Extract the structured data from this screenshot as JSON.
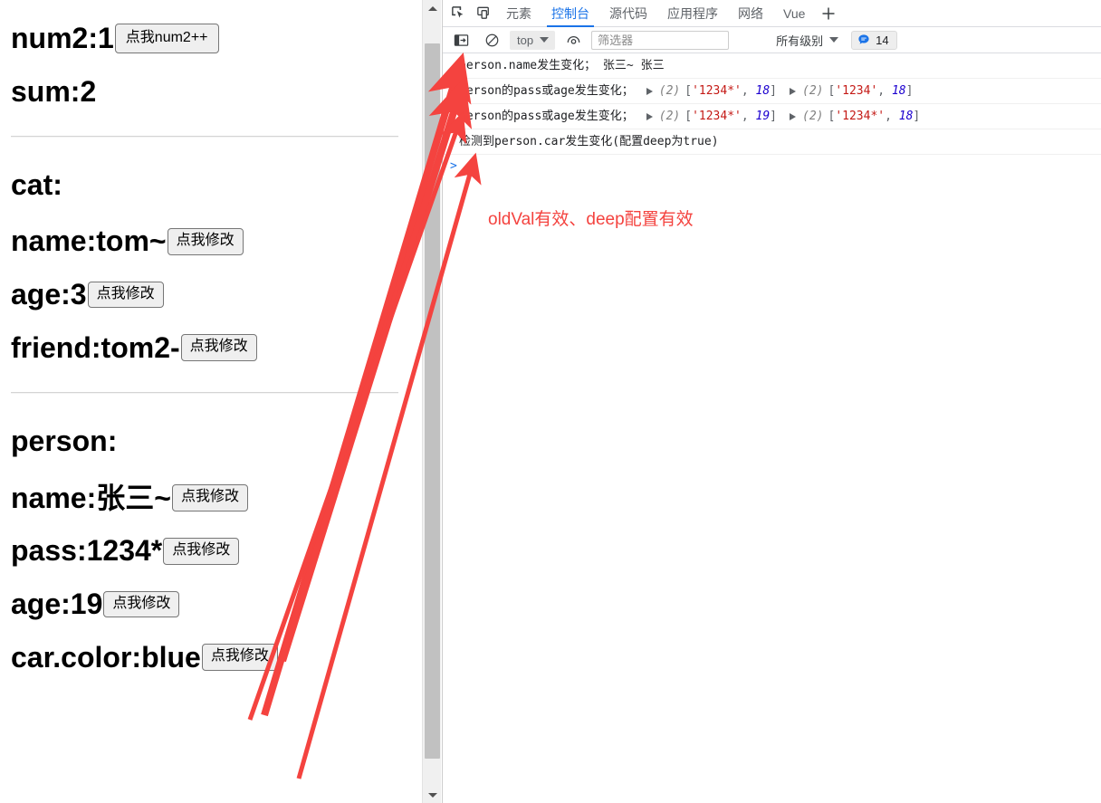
{
  "page": {
    "clipped_button_above": "",
    "rows": [
      {
        "label": "num2:",
        "value": "1",
        "button": "点我num2++",
        "wide": true
      },
      {
        "label": "sum:",
        "value": "2",
        "button": null
      }
    ],
    "cat_heading": "cat:",
    "cat_rows": [
      {
        "label": "name:",
        "value": "tom~",
        "button": "点我修改"
      },
      {
        "label": "age:",
        "value": "3",
        "button": "点我修改"
      },
      {
        "label": "friend:",
        "value": "tom2-",
        "button": "点我修改"
      }
    ],
    "person_heading": "person:",
    "person_rows": [
      {
        "label": "name:",
        "value": "张三~",
        "button": "点我修改"
      },
      {
        "label": "pass:",
        "value": "1234*",
        "button": "点我修改"
      },
      {
        "label": "age:",
        "value": "19",
        "button": "点我修改"
      },
      {
        "label": "car.color:",
        "value": "blue",
        "button": "点我修改"
      }
    ]
  },
  "devtools": {
    "tabs": [
      {
        "label": "元素",
        "active": false
      },
      {
        "label": "控制台",
        "active": true
      },
      {
        "label": "源代码",
        "active": false
      },
      {
        "label": "应用程序",
        "active": false
      },
      {
        "label": "网络",
        "active": false
      },
      {
        "label": "Vue",
        "active": false
      }
    ],
    "more_tabs_label": "+",
    "toolbar": {
      "context": "top",
      "filter_placeholder": "筛选器",
      "filter_value": "",
      "level": "所有级别",
      "message_count": "14"
    },
    "console": {
      "rows": [
        {
          "text": "person.name发生变化； 张三~ 张三",
          "objects": []
        },
        {
          "text": "person的pass或age发生变化；",
          "objects": [
            {
              "len": "(2)",
              "items": [
                {
                  "t": "str",
                  "v": "'1234*'"
                },
                {
                  "t": "num",
                  "v": "18"
                }
              ]
            },
            {
              "len": "(2)",
              "items": [
                {
                  "t": "str",
                  "v": "'1234'"
                },
                {
                  "t": "num",
                  "v": "18"
                }
              ]
            }
          ]
        },
        {
          "text": "person的pass或age发生变化；",
          "objects": [
            {
              "len": "(2)",
              "items": [
                {
                  "t": "str",
                  "v": "'1234*'"
                },
                {
                  "t": "num",
                  "v": "19"
                }
              ]
            },
            {
              "len": "(2)",
              "items": [
                {
                  "t": "str",
                  "v": "'1234*'"
                },
                {
                  "t": "num",
                  "v": "18"
                }
              ]
            }
          ]
        },
        {
          "text": "检测到person.car发生变化(配置deep为true)",
          "objects": []
        }
      ],
      "prompt": ">"
    },
    "annotation": {
      "note": "oldVal有效、deep配置有效",
      "color": "#f4433f"
    }
  },
  "icons": {
    "inspect": "inspect-element-icon",
    "device": "device-toolbar-icon",
    "sidebar": "console-sidebar-icon",
    "clear": "clear-console-icon",
    "eye": "live-expression-icon",
    "message": "message-count-icon"
  }
}
